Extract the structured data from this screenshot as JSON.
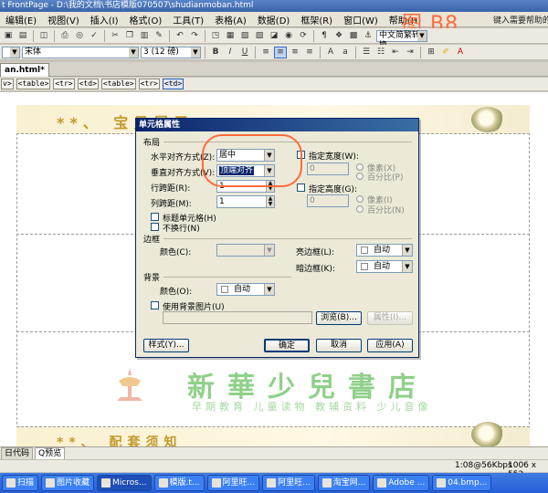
{
  "window": {
    "title": "t FrontPage - D:\\我的文档\\书店模版070507\\shudianmoban.html"
  },
  "annotation": {
    "figure_label": "图 B8",
    "color": "#ff6b3a"
  },
  "menu": [
    "编辑(E)",
    "视图(V)",
    "插入(I)",
    "格式(O)",
    "工具(T)",
    "表格(A)",
    "数据(D)",
    "框架(R)",
    "窗口(W)",
    "帮助(H)"
  ],
  "help_search": "键入需要帮助的问",
  "toolbar": {
    "font_name": "宋体",
    "font_size": "3 (12 磅)",
    "dropdown_text": "中文简繁转换"
  },
  "doc_tab": "an.html*",
  "quick_tags": [
    "v>",
    "<table>",
    "<tr>",
    "<td>",
    "<table>",
    "<tr>",
    "<td>"
  ],
  "page": {
    "banner_text": "**、 宝贝展示",
    "brand_name": "新華少兒書店",
    "slogan": "早期教育 儿童读物 教辅资料 少儿音像",
    "bottom_banner_text": "**、 配套须知"
  },
  "dialog": {
    "title": "单元格属性",
    "layout_label": "布局",
    "h_align_label": "水平对齐方式(Z):",
    "h_align_value": "居中",
    "v_align_label": "垂直对齐方式(V):",
    "v_align_value": "顶端对齐",
    "row_span_label": "行跨距(R):",
    "row_span_value": "1",
    "col_span_label": "列跨距(M):",
    "col_span_value": "1",
    "header_cell_label": "标题单元格(H)",
    "no_wrap_label": "不换行(N)",
    "width_label": "指定宽度(W):",
    "width_value": "0",
    "height_label": "指定高度(G):",
    "height_value": "0",
    "pixels_label": "像素(X)",
    "percent_label": "百分比(P)",
    "pixels_label_2": "像素(I)",
    "percent_label_2": "百分比(N)",
    "border_label": "边框",
    "border_color_label": "颜色(C):",
    "light_border_label": "亮边框(L):",
    "light_border_value": "自动",
    "dark_border_label": "暗边框(K):",
    "dark_border_value": "自动",
    "background_label": "背景",
    "bg_color_label": "颜色(O):",
    "bg_color_value": "自动",
    "bg_image_label": "使用背景图片(U)",
    "browse_label": "浏览(B)...",
    "properties_label": "属性(I)...",
    "style_label": "样式(Y)...",
    "ok_label": "确定",
    "cancel_label": "取消",
    "apply_label": "应用(A)"
  },
  "view_tabs": [
    "日代码",
    "Q预览"
  ],
  "status": {
    "speed": "1:08@56Kbps",
    "dims": "1006 x 552"
  },
  "taskbar": [
    "扫描",
    "图片收藏",
    "Micros...",
    "模版.t...",
    "阿里旺...",
    "阿里旺...",
    "淘宝网...",
    "Adobe ...",
    "04.bmp..."
  ]
}
